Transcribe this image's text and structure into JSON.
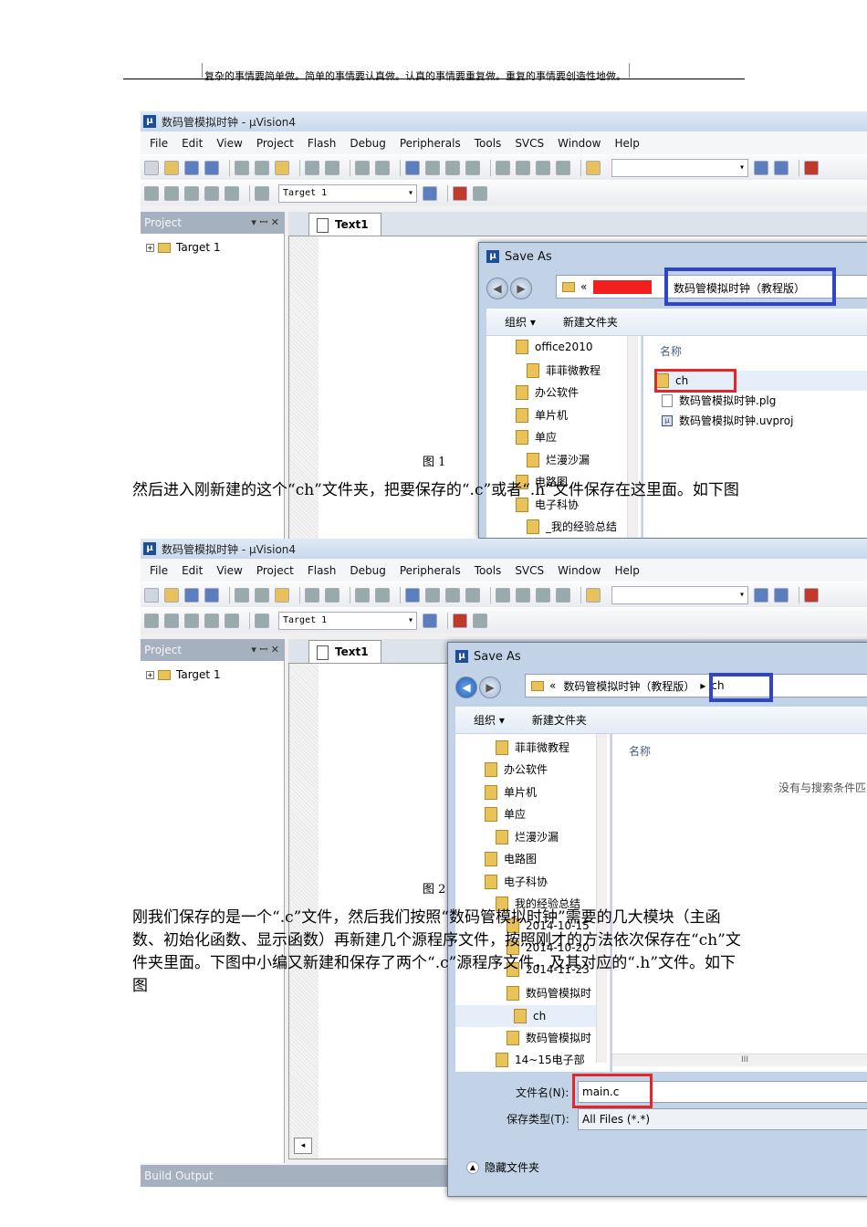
{
  "header": {
    "text": "复杂的事情要简单做。简单的事情要认真做。认真的事情要重复做。重复的事情要创造性地做。"
  },
  "app": {
    "title": "数码管模拟时钟  - µVision4",
    "menu": [
      "File",
      "Edit",
      "View",
      "Project",
      "Flash",
      "Debug",
      "Peripherals",
      "Tools",
      "SVCS",
      "Window",
      "Help"
    ],
    "target_combo": "Target 1",
    "project_panel": "Project",
    "project_panel_controls": "▾ ꟷ ✕",
    "tree_item": "Target 1",
    "tab": "Text1",
    "build_output": "Build Output"
  },
  "figure1": {
    "caption": "图 1",
    "dialog": {
      "title": "Save As",
      "path_prefix": "«",
      "path_folder": "数码管模拟时钟（教程版）",
      "organize": "组织 ▾",
      "new_folder": "新建文件夹",
      "nav_items": [
        "office2010",
        "菲菲微教程",
        "办公软件",
        "单片机",
        "单应",
        "烂漫沙漏",
        "电路图",
        "电子科协",
        "_我的经验总结"
      ],
      "col_name": "名称",
      "files": [
        {
          "name": "ch",
          "kind": "folder"
        },
        {
          "name": "数码管模拟时钟.plg",
          "kind": "file"
        },
        {
          "name": "数码管模拟时钟.uvproj",
          "kind": "project"
        }
      ]
    }
  },
  "para1": "然后进入刚新建的这个“ch”文件夹，把要保存的“.c”或者“.h”文件保存在这里面。如下图",
  "figure2": {
    "caption": "图 2",
    "dialog": {
      "title": "Save As",
      "path_prefix": "«",
      "path_parent": "数码管模拟时钟（教程版）",
      "path_folder": "ch",
      "organize": "组织 ▾",
      "new_folder": "新建文件夹",
      "nav_items": [
        "菲菲微教程",
        "办公软件",
        "单片机",
        "单应",
        "烂漫沙漏",
        "电路图",
        "电子科协",
        "我的经验总结",
        "2014-10-15",
        "2014-10-20",
        "2014-11-23",
        "数码管模拟时",
        "ch",
        "数码管模拟时",
        "14~15电子部"
      ],
      "col_name": "名称",
      "empty_msg": "没有与搜索条件匹",
      "filename_label": "文件名(N):",
      "filename_value": "main.c",
      "filetype_label": "保存类型(T):",
      "filetype_value": "All Files (*.*)",
      "hide_folders": "隐藏文件夹",
      "hscroll_mark": "III"
    }
  },
  "para2": "刚我们保存的是一个“.c”文件，然后我们按照“数码管模拟时钟”需要的几大模块（主函数、初始化函数、显示函数）再新建几个源程序文件，按照刚才的方法依次保存在“ch”文件夹里面。下图中小编又新建和保存了两个“.c”源程序文件，及其对应的“.h”文件。如下图",
  "colors": {
    "red_highlight": "#e3262a",
    "blue_highlight": "#2e44c9"
  }
}
